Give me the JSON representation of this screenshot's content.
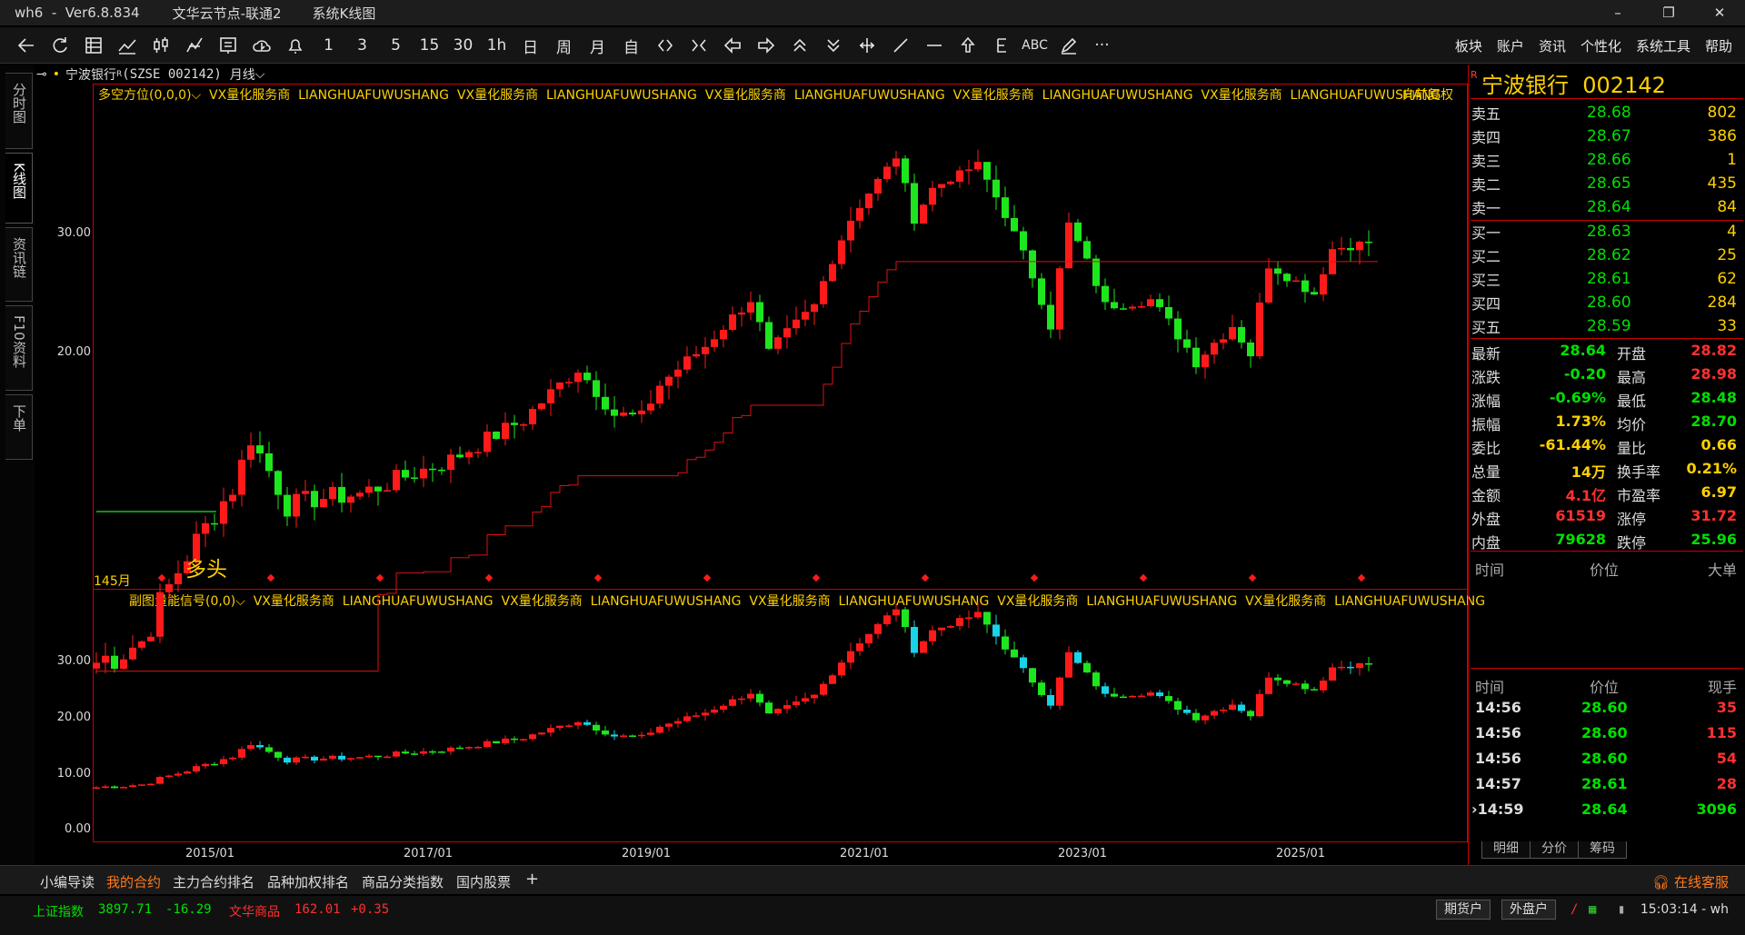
{
  "window": {
    "app": "wh6  -  Ver6.8.834",
    "server": "文华云节点-联通2",
    "view": "系统K线图"
  },
  "window_controls": [
    "–",
    "❐",
    "✕"
  ],
  "menu": [
    "板块",
    "账户",
    "资讯",
    "个性化",
    "系统工具",
    "帮助"
  ],
  "toolbar_text": [
    "1",
    "3",
    "5",
    "15",
    "30",
    "1h",
    "日",
    "周",
    "月",
    "自",
    "ABC",
    "···"
  ],
  "side_tabs": [
    "分时图",
    "K线图",
    "资讯链",
    "F10资料",
    "下单"
  ],
  "stock": {
    "name": "宁波银行",
    "code": "(SZSE 002142)",
    "period": "月线",
    "badge": "R"
  },
  "indicator_main": "多空方位(0,0,0)⌵  VX量化服务商  LIANGHUAFUWUSHANG  VX量化服务商  LIANGHUAFUWUSHANG  VX量化服务商  LIANGHUAFUWUSHANG  VX量化服务商  LIANGHUAFUWUSHANG  VX量化服务商  LIANGHUAFUWUSHANG",
  "fuquan": "向前复权",
  "indicator_sub": "副图量能信号(0,0)⌵  VX量化服务商  LIANGHUAFUWUSHANG  VX量化服务商  LIANGHUAFUWUSHANG  VX量化服务商  LIANGHUAFUWUSHANG  VX量化服务商  LIANGHUAFUWUSHANG  VX量化服务商  LIANGHUAFUWUSHANG",
  "main_labels": {
    "duotou": "多头",
    "count": "145月"
  },
  "y_main": [
    "30.00",
    "20.00"
  ],
  "y_sub": [
    "30.00",
    "20.00",
    "10.00",
    "0.00"
  ],
  "x_axis": [
    "2015/01",
    "2017/01",
    "2019/01",
    "2021/01",
    "2023/01",
    "2025/01"
  ],
  "quote_title": "宁波银行  002142",
  "order_book": {
    "asks": [
      {
        "label": "卖五",
        "price": "28.68",
        "vol": "802"
      },
      {
        "label": "卖四",
        "price": "28.67",
        "vol": "386"
      },
      {
        "label": "卖三",
        "price": "28.66",
        "vol": "1"
      },
      {
        "label": "卖二",
        "price": "28.65",
        "vol": "435"
      },
      {
        "label": "卖一",
        "price": "28.64",
        "vol": "84"
      }
    ],
    "bids": [
      {
        "label": "买一",
        "price": "28.63",
        "vol": "4"
      },
      {
        "label": "买二",
        "price": "28.62",
        "vol": "25"
      },
      {
        "label": "买三",
        "price": "28.61",
        "vol": "62"
      },
      {
        "label": "买四",
        "price": "28.60",
        "vol": "284"
      },
      {
        "label": "买五",
        "price": "28.59",
        "vol": "33"
      }
    ]
  },
  "stats": [
    {
      "l1": "最新",
      "v1": "28.64",
      "c1": "green",
      "l2": "开盘",
      "v2": "28.82",
      "c2": "red"
    },
    {
      "l1": "涨跌",
      "v1": "-0.20",
      "c1": "green",
      "l2": "最高",
      "v2": "28.98",
      "c2": "red"
    },
    {
      "l1": "涨幅",
      "v1": "-0.69%",
      "c1": "green",
      "l2": "最低",
      "v2": "28.48",
      "c2": "green"
    },
    {
      "l1": "振幅",
      "v1": "1.73%",
      "c1": "yel",
      "l2": "均价",
      "v2": "28.70",
      "c2": "green"
    },
    {
      "l1": "委比",
      "v1": "-61.44%",
      "c1": "yel",
      "l2": "量比",
      "v2": "0.66",
      "c2": "yel"
    },
    {
      "l1": "总量",
      "v1": "14万",
      "c1": "yel",
      "l2": "换手率",
      "v2": "0.21%",
      "c2": "yel"
    },
    {
      "l1": "金额",
      "v1": "4.1亿",
      "c1": "red",
      "l2": "市盈率",
      "v2": "6.97",
      "c2": "yel"
    },
    {
      "l1": "外盘",
      "v1": "61519",
      "c1": "red",
      "l2": "涨停",
      "v2": "31.72",
      "c2": "red"
    },
    {
      "l1": "内盘",
      "v1": "79628",
      "c1": "green",
      "l2": "跌停",
      "v2": "25.96",
      "c2": "green"
    }
  ],
  "big_header": [
    "时间",
    "价位",
    "大单"
  ],
  "tick_header": [
    "时间",
    "价位",
    "现手"
  ],
  "ticks": [
    {
      "t": "14:56",
      "p": "28.60",
      "v": "35",
      "pc": "green",
      "vc": "red"
    },
    {
      "t": "14:56",
      "p": "28.60",
      "v": "115",
      "pc": "green",
      "vc": "red"
    },
    {
      "t": "14:56",
      "p": "28.60",
      "v": "54",
      "pc": "green",
      "vc": "red"
    },
    {
      "t": "14:57",
      "p": "28.61",
      "v": "28",
      "pc": "green",
      "vc": "red"
    },
    {
      "t": "›14:59",
      "p": "28.64",
      "v": "3096",
      "pc": "green",
      "vc": "green"
    }
  ],
  "right_tabs": [
    "明细",
    "分价",
    "筹码"
  ],
  "bottom_tabs": [
    "小编导读",
    "我的合约",
    "主力合约排名",
    "品种加权排名",
    "商品分类指数",
    "国内股票",
    "+"
  ],
  "service": "在线客服",
  "status": {
    "idx1_name": "上证指数",
    "idx1_val": "3897.71",
    "idx1_chg": "-16.29",
    "idx2_name": "文华商品",
    "idx2_val": "162.01",
    "idx2_chg": "+0.35",
    "btn1": "期货户",
    "btn2": "外盘户",
    "clock": "15:03:14 - wh"
  },
  "chart_data": {
    "type": "candlestick",
    "period": "monthly",
    "y_axis_ticks": [
      20,
      30
    ],
    "x_ticks": [
      "2015/01",
      "2017/01",
      "2019/01",
      "2021/01",
      "2023/01",
      "2025/01"
    ],
    "anchors": [
      [
        "2014/01",
        6.7
      ],
      [
        "2014/06",
        7.2
      ],
      [
        "2015/04",
        12.2
      ],
      [
        "2015/06",
        14.5
      ],
      [
        "2015/10",
        11.5
      ],
      [
        "2016/01",
        11.8
      ],
      [
        "2016/06",
        12.0
      ],
      [
        "2017/04",
        13.5
      ],
      [
        "2017/12",
        15.5
      ],
      [
        "2018/06",
        18.5
      ],
      [
        "2018/10",
        15.8
      ],
      [
        "2019/01",
        15.6
      ],
      [
        "2019/03",
        17.5
      ],
      [
        "2019/08",
        20.0
      ],
      [
        "2020/01",
        23.5
      ],
      [
        "2020/03",
        19.5
      ],
      [
        "2020/08",
        23.0
      ],
      [
        "2020/12",
        31.0
      ],
      [
        "2021/05",
        38.5
      ],
      [
        "2021/07",
        31.0
      ],
      [
        "2021/09",
        34.5
      ],
      [
        "2022/02",
        37.5
      ],
      [
        "2022/05",
        31.5
      ],
      [
        "2022/10",
        21.5
      ],
      [
        "2022/12",
        30.5
      ],
      [
        "2023/04",
        23.0
      ],
      [
        "2023/09",
        23.5
      ],
      [
        "2024/02",
        19.0
      ],
      [
        "2024/06",
        21.5
      ],
      [
        "2024/08",
        19.5
      ],
      [
        "2024/10",
        26.5
      ],
      [
        "2025/03",
        24.0
      ],
      [
        "2025/05",
        28.0
      ],
      [
        "2025/09",
        28.64
      ]
    ]
  }
}
